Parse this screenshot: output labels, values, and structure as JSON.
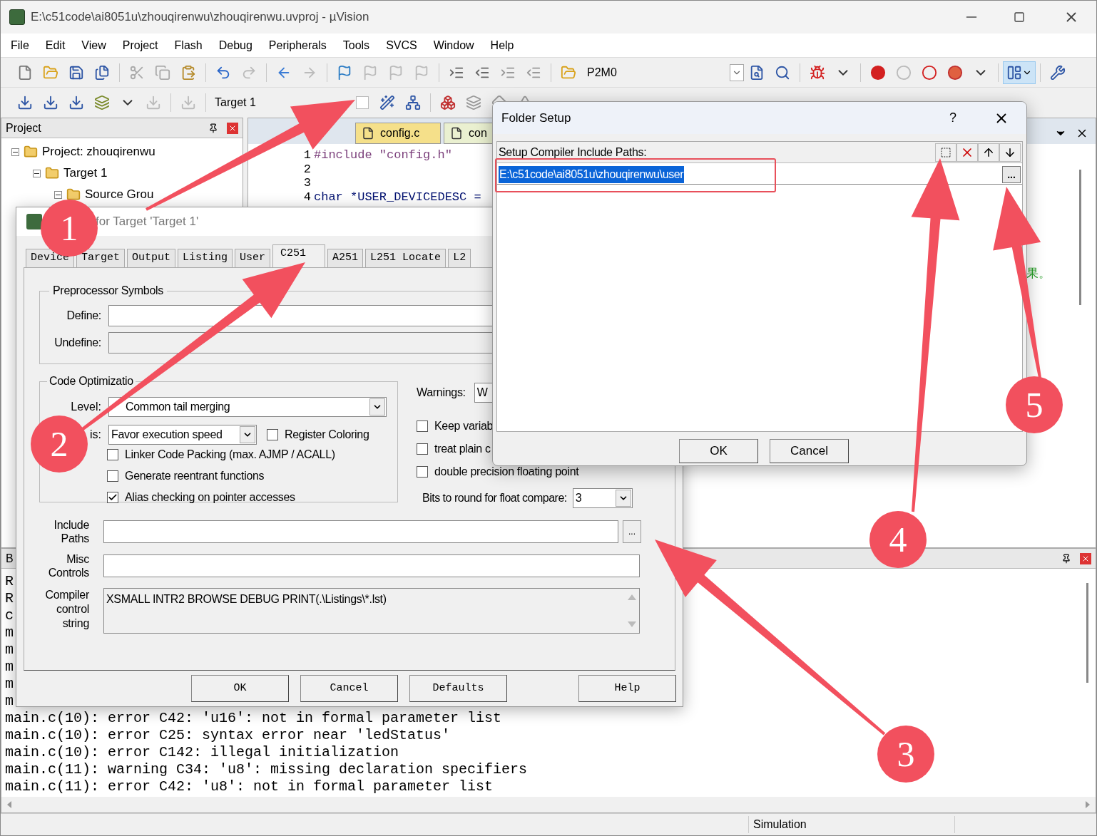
{
  "window": {
    "title": "E:\\c51code\\ai8051u\\zhouqirenwu\\zhouqirenwu.uvproj - µVision"
  },
  "menu": [
    "File",
    "Edit",
    "View",
    "Project",
    "Flash",
    "Debug",
    "Peripherals",
    "Tools",
    "SVCS",
    "Window",
    "Help"
  ],
  "toolbar": {
    "find_combo": "P2M0",
    "target": "Target 1"
  },
  "project_panel": {
    "title": "Project",
    "tree": [
      {
        "label": "Project: zhouqirenwu",
        "expanded": true,
        "children": [
          {
            "label": "Target 1",
            "expanded": true,
            "children": [
              {
                "label": "Source Grou",
                "expanded": true
              }
            ]
          }
        ]
      }
    ]
  },
  "editor": {
    "tabs": [
      {
        "label": "config.c",
        "kind": "source"
      },
      {
        "label": "con",
        "kind": "header"
      }
    ],
    "lines": [
      {
        "number": "1",
        "code": "#include \"config.h\""
      },
      {
        "number": "2"
      },
      {
        "number": "3"
      },
      {
        "number": "4",
        "code": "char *USER_DEVICEDESC ="
      }
    ],
    "comment_fragment": "果。"
  },
  "build_output": {
    "title": "B",
    "lines": [
      "R",
      "R",
      "c",
      "m",
      "m",
      "m",
      "m",
      "m",
      "main.c(10): error C42: 'u16': not in formal parameter list",
      "main.c(10): error C25: syntax error near 'ledStatus'",
      "main.c(10): error C142: illegal initialization",
      "main.c(11): warning C34: 'u8': missing declaration specifiers",
      "main.c(11): error C42: 'u8': not in formal parameter list"
    ]
  },
  "status_bar": {
    "mode": "Simulation"
  },
  "options_dialog": {
    "title": "for Target 'Target 1'",
    "tabs": [
      {
        "label": "Device",
        "selected": false
      },
      {
        "label": "Target",
        "selected": false
      },
      {
        "label": "Output",
        "selected": false
      },
      {
        "label": "Listing",
        "selected": false
      },
      {
        "label": "User",
        "selected": false
      },
      {
        "label": "C251",
        "selected": true
      },
      {
        "label": "A251",
        "selected": false
      },
      {
        "label": "L251 Locate",
        "selected": false
      },
      {
        "label": "L2",
        "selected": false
      }
    ],
    "preprocessor": {
      "title": "Preprocessor Symbols",
      "fields": [
        {
          "label": "Define:",
          "disabled": false
        },
        {
          "label": "Undefine:",
          "disabled": true
        }
      ]
    },
    "optimization": {
      "title": "Code Optimizatio",
      "level_label": "Level:",
      "level": "Common tail merging",
      "emphasis_label": "is:",
      "emphasis": "Favor execution speed",
      "register_coloring": {
        "label": "Register Coloring",
        "checked": false
      },
      "options": [
        {
          "label": "Linker Code Packing (max. AJMP / ACALL)",
          "checked": false
        },
        {
          "label": "Generate reentrant functions",
          "checked": false
        },
        {
          "label": "Alias checking on pointer accesses",
          "checked": true
        }
      ]
    },
    "warnings_label": "Warnings:",
    "warnings": "W",
    "right_options": [
      {
        "label": "Keep variab",
        "checked": false
      },
      {
        "label": "treat plain c",
        "checked": false
      },
      {
        "label": "double precision floating point",
        "checked": false
      }
    ],
    "bits_label": "Bits to round for float compare:",
    "bits": "3",
    "include_label": "Include Paths",
    "browse": "...",
    "misc_label": "Misc Controls",
    "control_label": "Compiler control string",
    "control_string": "XSMALL INTR2 BROWSE DEBUG PRINT(.\\Listings\\*.lst)",
    "buttons": [
      "OK",
      "Cancel",
      "Defaults",
      "Help"
    ]
  },
  "folder_setup": {
    "title": "Folder Setup",
    "help": "?",
    "label": "Setup Compiler Include Paths:",
    "paths": [
      {
        "path": "E:\\c51code\\ai8051u\\zhouqirenwu\\user",
        "selected": true
      }
    ],
    "browse": "...",
    "buttons": [
      "OK",
      "Cancel"
    ]
  },
  "annotations": [
    {
      "label": "1"
    },
    {
      "label": "2"
    },
    {
      "label": "3"
    },
    {
      "label": "4"
    },
    {
      "label": "5"
    }
  ]
}
